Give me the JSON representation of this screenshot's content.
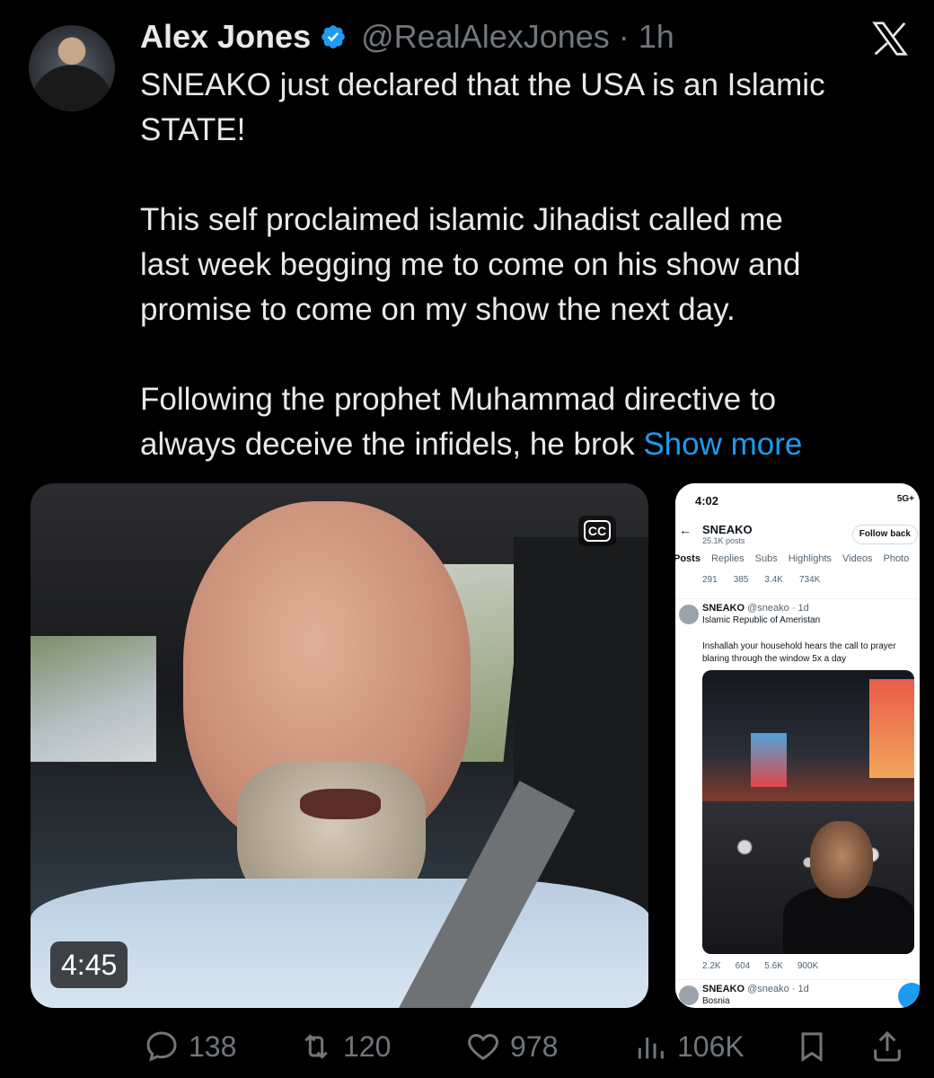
{
  "author": {
    "display_name": "Alex Jones",
    "handle": "@RealAlexJones",
    "separator": "·",
    "time": "1h",
    "verified_color": "#1d9bf0"
  },
  "tweet": {
    "line1": "SNEAKO just declared that the USA is an Islamic",
    "line2": "STATE!",
    "para2_line1": "This self proclaimed islamic Jihadist called me",
    "para2_line2": "last week begging me to come on his show and",
    "para2_line3": "promise to come on my show the next day.",
    "para3_line1": "Following the prophet Muhammad directive to",
    "para3_line2": "always deceive the infidels, he brok",
    "show_more": "Show more"
  },
  "video": {
    "duration": "4:45",
    "cc_label": "CC"
  },
  "screenshot": {
    "status_time": "4:02",
    "status_signal": "5G+",
    "profile_name": "SNEAKO",
    "profile_posts": "25.1K posts",
    "follow_button": "Follow back",
    "tabs": [
      "Posts",
      "Replies",
      "Subs",
      "Highlights",
      "Videos",
      "Photo"
    ],
    "top_stats": [
      "291",
      "385",
      "3.4K",
      "734K"
    ],
    "tweet_name": "SNEAKO",
    "tweet_handle": "@sneako · 1d",
    "tweet_bio": "Islamic Republic of Ameristan",
    "tweet_body_line1": "Inshallah your household hears the call to prayer",
    "tweet_body_line2": "blaring through the window 5x a day",
    "bottom_stats": [
      "2.2K",
      "604",
      "5.6K",
      "900K"
    ],
    "tweet2_name": "SNEAKO",
    "tweet2_handle": "@sneako · 1d",
    "tweet2_text": "Bosnia"
  },
  "actions": {
    "replies": "138",
    "retweets": "120",
    "likes": "978",
    "views": "106K"
  }
}
